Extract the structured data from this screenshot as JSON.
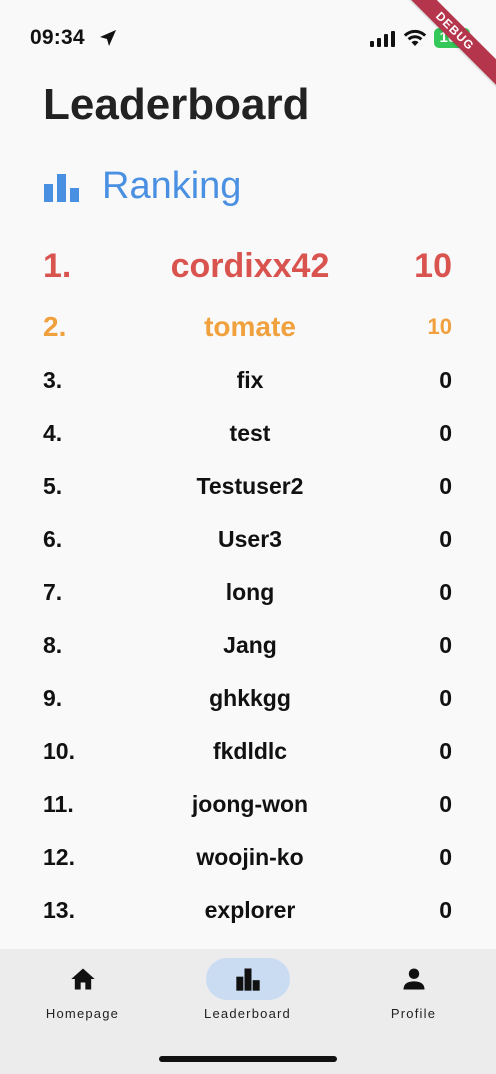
{
  "status_bar": {
    "time": "09:34",
    "battery": "100"
  },
  "debug_banner": "DEBUG",
  "page_title": "Leaderboard",
  "section": {
    "icon": "bar-chart-icon",
    "title": "Ranking"
  },
  "ranking": [
    {
      "position": "1.",
      "name": "cordixx42",
      "score": "10"
    },
    {
      "position": "2.",
      "name": "tomate",
      "score": "10"
    },
    {
      "position": "3.",
      "name": "fix",
      "score": "0"
    },
    {
      "position": "4.",
      "name": "test",
      "score": "0"
    },
    {
      "position": "5.",
      "name": "Testuser2",
      "score": "0"
    },
    {
      "position": "6.",
      "name": "User3",
      "score": "0"
    },
    {
      "position": "7.",
      "name": "long",
      "score": "0"
    },
    {
      "position": "8.",
      "name": "Jang",
      "score": "0"
    },
    {
      "position": "9.",
      "name": "ghkkgg",
      "score": "0"
    },
    {
      "position": "10.",
      "name": "fkdldlc",
      "score": "0"
    },
    {
      "position": "11.",
      "name": "joong-won",
      "score": "0"
    },
    {
      "position": "12.",
      "name": "woojin-ko",
      "score": "0"
    },
    {
      "position": "13.",
      "name": "explorer",
      "score": "0"
    }
  ],
  "nav": {
    "items": [
      {
        "label": "Homepage",
        "icon": "home-icon",
        "active": false
      },
      {
        "label": "Leaderboard",
        "icon": "leaderboard-icon",
        "active": true
      },
      {
        "label": "Profile",
        "icon": "person-icon",
        "active": false
      }
    ]
  },
  "colors": {
    "accent": "#4a90e2",
    "first_place": "#d9534f",
    "second_place": "#f0a03c",
    "nav_active_pill": "#c9dcf2",
    "battery": "#34c759",
    "debug_banner": "#b5364c"
  }
}
